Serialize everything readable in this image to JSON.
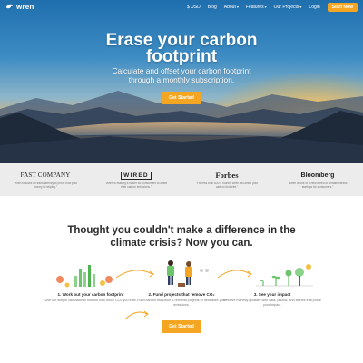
{
  "brand": {
    "name": "wren",
    "accent_color": "#f4a623"
  },
  "nav": {
    "items": [
      {
        "label": "$ USD",
        "has_caret": false
      },
      {
        "label": "Blog",
        "has_caret": false
      },
      {
        "label": "About",
        "has_caret": true
      },
      {
        "label": "Features",
        "has_caret": true
      },
      {
        "label": "Our Projects",
        "has_caret": true
      },
      {
        "label": "Login",
        "has_caret": false
      }
    ],
    "cta_label": "Start Now"
  },
  "hero": {
    "title_lines": [
      "Erase your carbon",
      "footprint"
    ],
    "subtitle_lines": [
      "Calculate and offset your carbon footprint",
      "through a monthly subscription."
    ],
    "cta_label": "Get Started"
  },
  "press": [
    {
      "logo_text": "FAST COMPANY",
      "quote": "\"Wren focuses on transparency to prove how your money is helping.\""
    },
    {
      "logo_text": "WIRED",
      "quote": "\"Wren is making it easier for consumers to offset their carbon emissions.\""
    },
    {
      "logo_text": "Forbes",
      "quote": "\"For less than $30 a month, Wren will offset your carbon footprint.\""
    },
    {
      "logo_text": "Bloomberg",
      "quote": "\"Wren is one of a new breed of climate-centric startups for consumers.\""
    }
  ],
  "headline_lines": [
    "Thought you couldn't make a difference in the",
    "climate crisis? Now you can."
  ],
  "steps": [
    {
      "title": "1. Work out your carbon footprint",
      "description": "Use our simple calculator to find out how much CO2 you emit.",
      "icon": "bar-chart-icon"
    },
    {
      "title": "2. Fund projects that remove CO₂",
      "description": "Fund carbon reduction & removal projects to neutralize your emissions.",
      "icon": "people-planting-icon"
    },
    {
      "title": "3. See your impact",
      "description": "Receive monthly updates with data, photos, and stories that prove your impact.",
      "icon": "growing-sprouts-icon"
    }
  ],
  "bottom_cta_label": "Get Started"
}
